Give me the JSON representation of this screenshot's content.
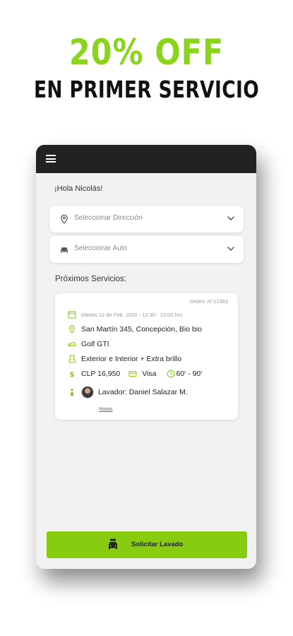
{
  "promo": {
    "headline": "20% OFF",
    "subheadline": "EN PRIMER SERVICIO"
  },
  "app": {
    "greeting": "¡Hola Nicolás!",
    "address_select": {
      "placeholder": "Seleccionar Dirección",
      "icon": "location-pin-icon"
    },
    "car_select": {
      "placeholder": "Seleccionar Auto",
      "icon": "car-icon"
    },
    "section_title": "Próximos Servicios:",
    "service": {
      "order": "Orden: N°12353",
      "date": "Martes 12 de Feb. 2020 - 12:30 - 13:00 hrs",
      "address": "San Martín 345, Concepción, Bio bio",
      "car": "Golf GTI",
      "service_type": "Exterior e Interior + Extra brillo",
      "price": "CLP 16,950",
      "payment": "Visa",
      "duration": "60' - 90'",
      "washer": "Lavador: Daniel Salazar M.",
      "notes_link": "Notas"
    },
    "cta_label": "Solicitar Lavado"
  },
  "colors": {
    "accent": "#88cc10",
    "topbar": "#222222",
    "background": "#f2f2f2"
  }
}
